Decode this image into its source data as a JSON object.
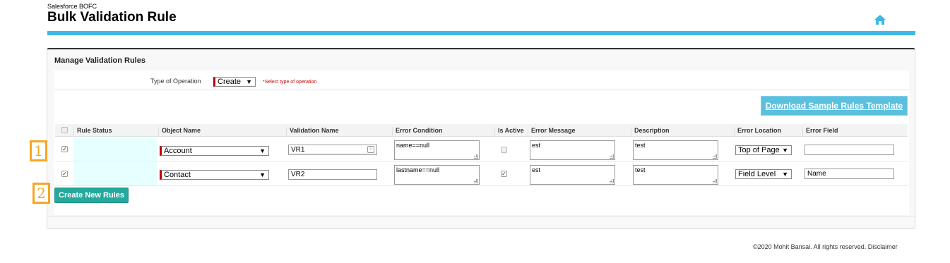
{
  "header": {
    "subtitle": "Salesforce BOFC",
    "title": "Bulk Validation Rule",
    "accent_color": "#3cb9e6",
    "home_icon": "home-icon"
  },
  "panel": {
    "title": "Manage Validation Rules",
    "operation": {
      "label": "Type of Operation",
      "selected": "Create",
      "hint": "*Select type of operation"
    },
    "download_button": "Download Sample Rules Template",
    "columns": [
      "Rule Status",
      "Object Name",
      "Validation Name",
      "Error Condition",
      "Is Active",
      "Error Message",
      "Description",
      "Error Location",
      "Error Field"
    ],
    "rows": [
      {
        "selected": true,
        "rule_status": "",
        "object_name": "Account",
        "validation_name": "VR1",
        "error_condition": "name==null",
        "is_active": false,
        "error_message": "est",
        "description": "test",
        "error_location": "Top of Page",
        "error_field": ""
      },
      {
        "selected": true,
        "rule_status": "",
        "object_name": "Contact",
        "validation_name": "VR2",
        "error_condition": "lastname==null",
        "is_active": true,
        "error_message": "est",
        "description": "test",
        "error_location": "Field Level",
        "error_field": "Name"
      }
    ],
    "create_button": "Create New Rules"
  },
  "markers": [
    "1",
    "2"
  ],
  "footer": "©2020 Mohit Bansal. All rights reserved. Disclaimer"
}
